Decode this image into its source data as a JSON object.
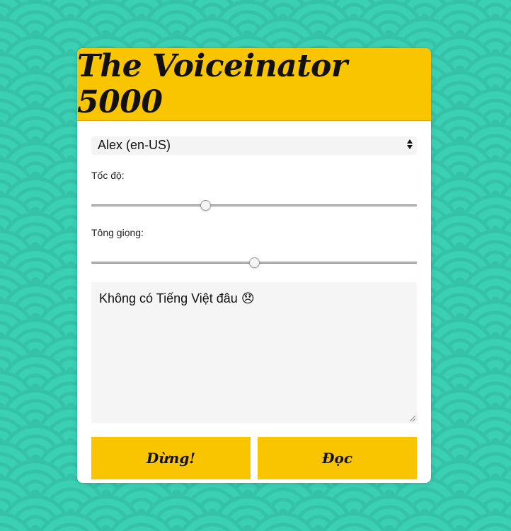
{
  "app": {
    "title": "The Voiceinator 5000"
  },
  "voice_select": {
    "selected": "Alex (en-US)"
  },
  "rate": {
    "label": "Tốc độ:",
    "value_fraction": 0.345
  },
  "pitch": {
    "label": "Tông giọng:",
    "value_fraction": 0.5
  },
  "message": {
    "text": "Không có Tiếng Việt đâu 😞"
  },
  "buttons": {
    "stop_label": "Dừng!",
    "speak_label": "Đọc"
  },
  "colors": {
    "accent": "#f9c500",
    "background": "#3bcfb4"
  },
  "icons": {
    "select_arrows": "chevron-up-down-icon",
    "resize": "resize-handle-icon"
  }
}
